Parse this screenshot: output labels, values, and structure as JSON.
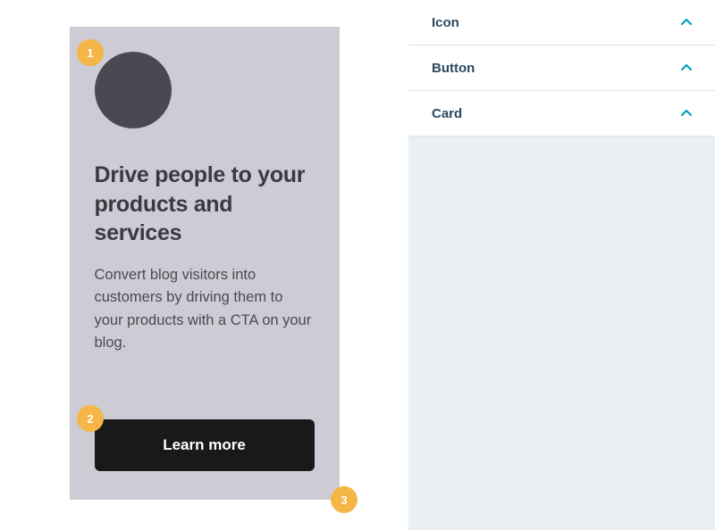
{
  "card": {
    "title": "Drive people to your products and services",
    "description": "Convert blog visitors into customers by driving them to your products with a CTA on your blog.",
    "button_label": "Learn more"
  },
  "markers": {
    "one": "1",
    "two": "2",
    "three": "3"
  },
  "sidebar": {
    "items": [
      {
        "label": "Icon"
      },
      {
        "label": "Button"
      },
      {
        "label": "Card"
      }
    ]
  },
  "colors": {
    "marker": "#f5b547",
    "accent": "#00a4bd",
    "card_bg": "#cdccd4",
    "icon_circle": "#494951",
    "button_bg": "#1a1919"
  }
}
